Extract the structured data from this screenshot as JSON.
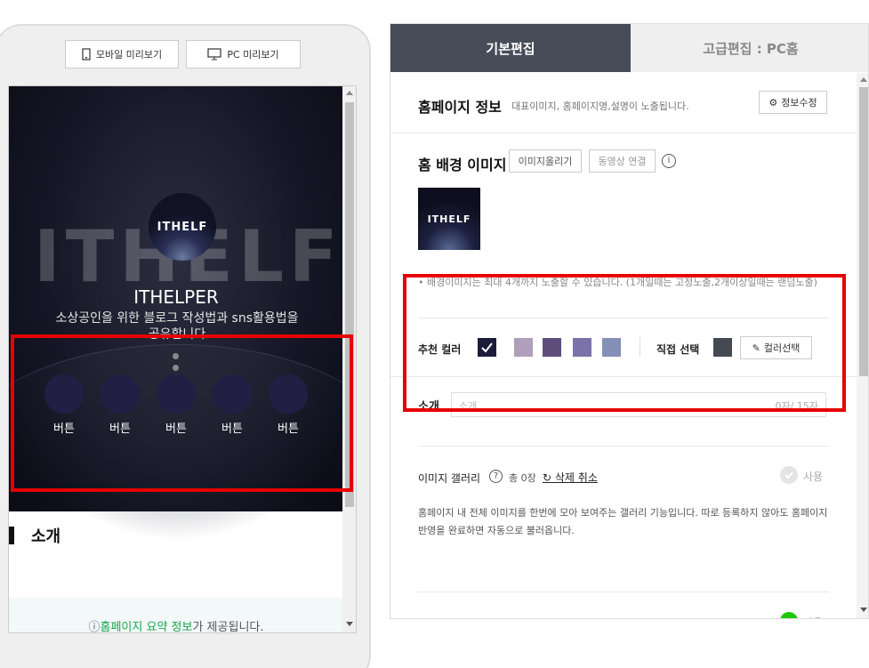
{
  "preview": {
    "mobile_label": "모바일 미리보기",
    "pc_label": "PC 미리보기",
    "hero": {
      "bg_text": "ITHELF",
      "logo_text": "ITHELF",
      "title": "ITHELPER",
      "subtitle": "소상공인을 위한 블로그 작성법과 sns활용법을 공유합니다",
      "buttons": [
        "버튼",
        "버튼",
        "버튼",
        "버튼",
        "버튼"
      ]
    },
    "intro_title": "소개",
    "summary_prefix": "ⓘ",
    "summary_link": "홈페이지 요약 정보",
    "summary_suffix": "가 제공됩니다."
  },
  "tabs": {
    "basic": "기본편집",
    "advanced": "고급편집 : PC홈"
  },
  "homepage_info": {
    "title": "홈페이지 정보",
    "desc": "대표이미지, 홈페이지명,설명이 노출됩니다.",
    "edit_button": "정보수정"
  },
  "bg_image": {
    "title": "홈 배경 이미지",
    "upload_button": "이미지올리기",
    "video_button": "동영상 연결",
    "thumb_text": "ITHELF",
    "note": "• 배경이미지는 최대 4개까지 노출할 수 있습니다. (1개일때는 고정노출,2개이상일때는 랜덤노출)"
  },
  "color": {
    "recommended_label": "추천 컬러",
    "swatches": [
      "#1c1c3a",
      "#b09fbb",
      "#5f4e7c",
      "#7a72a8",
      "#8590b8"
    ],
    "custom_label": "직접 선택",
    "custom_color": "#454a52",
    "picker_button": "컬러선택"
  },
  "intro": {
    "label": "소개",
    "placeholder": "소개",
    "counter": "0자/ 15자"
  },
  "gallery": {
    "title": "이미지 갤러리",
    "count": "총 0장",
    "undo": "삭제 취소",
    "use_label": "사용",
    "desc": "홈페이지 내 전체 이미지를 한번에 모아 보여주는 갤러리 기능입니다. 따로 등록하지 않아도 홈페이지 반영을 완료하면 자동으로 불러옵니다."
  },
  "next_section": {
    "use_label": "사용"
  }
}
